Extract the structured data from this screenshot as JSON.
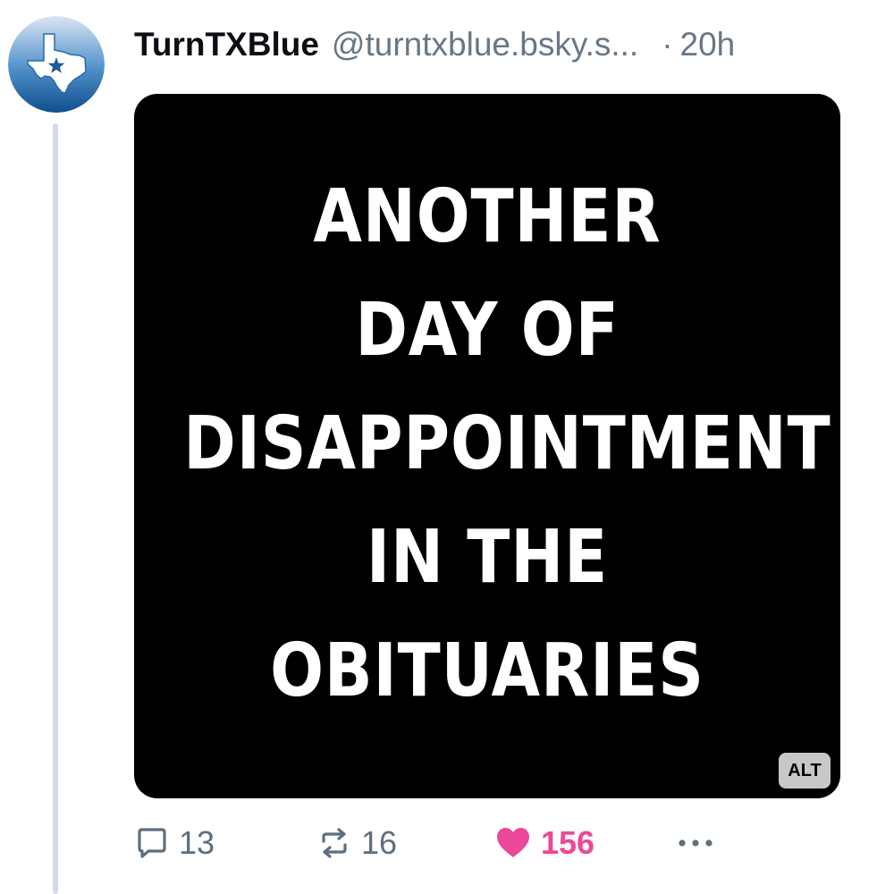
{
  "post": {
    "display_name": "TurnTXBlue",
    "handle": "@turntxblue.bsky.s...",
    "separator": "·",
    "timestamp": "20h",
    "avatar_icon": "texas-star-icon",
    "image": {
      "lines": [
        "ANOTHER",
        "DAY OF",
        "DISAPPOINTMENT",
        "IN THE",
        "OBITUARIES"
      ],
      "alt_badge": "ALT"
    },
    "actions": {
      "reply_count": "13",
      "repost_count": "16",
      "like_count": "156",
      "liked": true
    }
  },
  "colors": {
    "like_active": "#ec4899",
    "muted_text": "#687785",
    "avatar_blue": "#1e5a96",
    "thread_line": "#d4dbe2"
  }
}
